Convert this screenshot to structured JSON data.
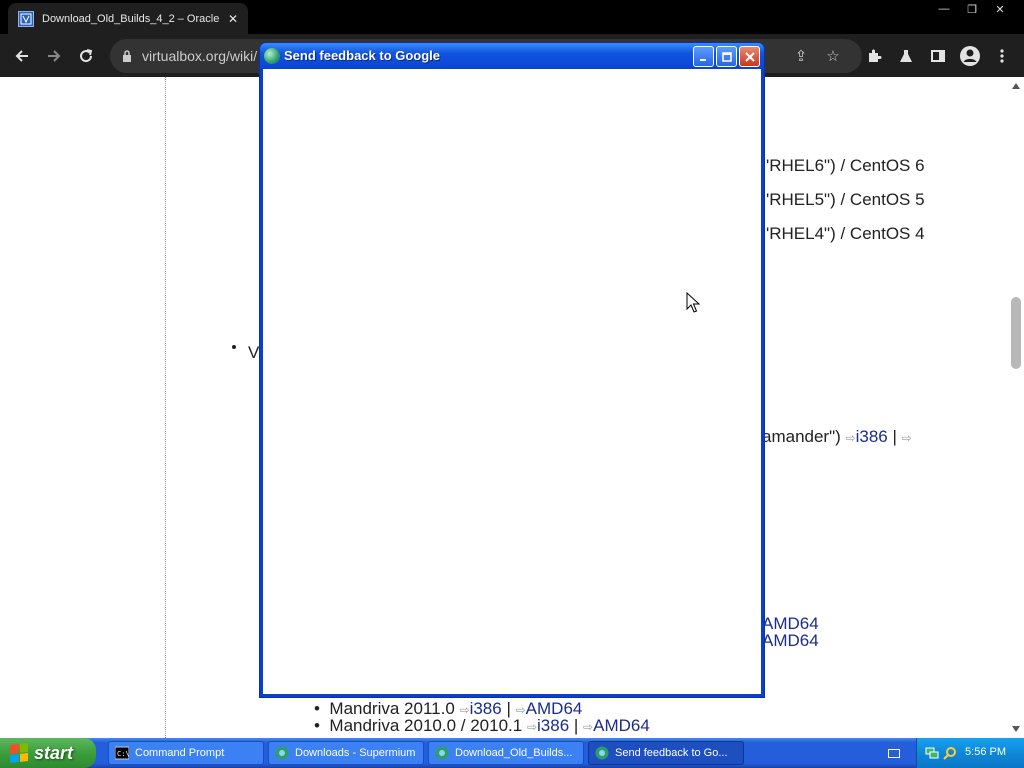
{
  "browser": {
    "tab_title": "Download_Old_Builds_4_2 – Oracle",
    "url": "virtualbox.org/wiki/",
    "icons": [
      "back-icon",
      "forward-icon",
      "reload-icon",
      "lock-icon",
      "share-icon",
      "star-icon",
      "extensions-icon",
      "labs-icon",
      "side-panel-icon",
      "profile-icon",
      "menu-icon"
    ]
  },
  "page": {
    "line1": "'RHEL6\") / CentOS 6",
    "line2": "'RHEL5\") / CentOS 5",
    "line3": "'RHEL4\") / CentOS 4",
    "bullet_letter": "V",
    "salamander_pre": "amander\")",
    "salamander_link": "i386",
    "sep": "|",
    "amd64_a": "AMD64",
    "amd64_b": "AMD64",
    "mandriva1_label": "Mandriva 2011.0",
    "mandriva1_i386": "i386",
    "mandriva1_amd64": "AMD64",
    "mandriva2_label": "Mandriva 2010.0 / 2010.1",
    "mandriva2_i386": "i386",
    "mandriva2_amd64": "AMD64"
  },
  "dialog": {
    "title": "Send feedback to Google"
  },
  "taskbar": {
    "start_label": "start",
    "tasks": [
      {
        "label": "Command Prompt"
      },
      {
        "label": "Downloads - Supermium"
      },
      {
        "label": "Download_Old_Builds..."
      },
      {
        "label": "Send feedback to Go..."
      }
    ],
    "clock": "5:56 PM"
  }
}
